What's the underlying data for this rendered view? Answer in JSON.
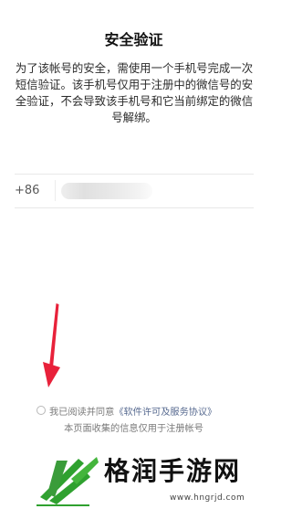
{
  "page": {
    "title": "安全验证",
    "description": "为了该帐号的安全，需使用一个手机号完成一次短信验证。该手机号仅用于注册中的微信号的安全验证，不会导致该手机号和它当前绑定的微信号解绑。"
  },
  "phone": {
    "country_code": "+86",
    "input_value": ""
  },
  "agreement": {
    "prefix": "我已阅读并同意",
    "link_text": "《软件许可及服务协议》",
    "checked": false
  },
  "notice": "本页面收集的信息仅用于注册帐号",
  "watermark": {
    "brand": "格润手游网",
    "url": "www.hngrjd.com"
  },
  "colors": {
    "link": "#56698f",
    "arrow": "#e8213a",
    "logo_green": "#2fa12f"
  }
}
